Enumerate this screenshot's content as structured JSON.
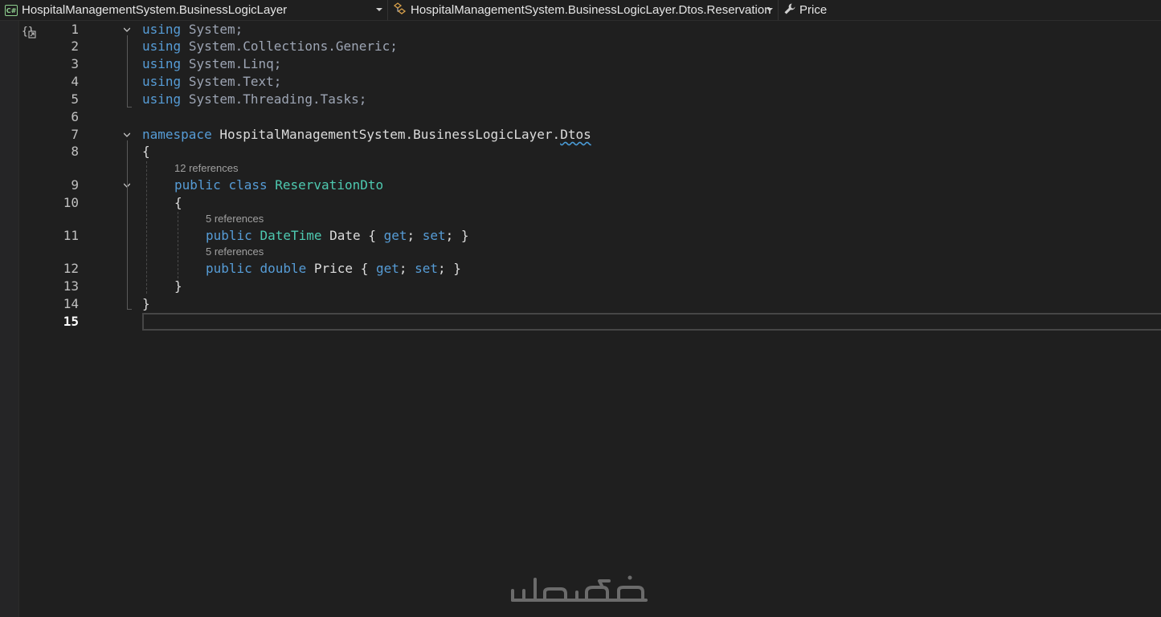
{
  "navbar": {
    "project_icon": "csharp-project-icon",
    "project": "HospitalManagementSystem.BusinessLogicLayer",
    "type_icon": "class-icon",
    "type": "HospitalManagementSystem.BusinessLogicLayer.Dtos.Reservation",
    "member_icon": "wrench-icon",
    "member": "Price"
  },
  "editor": {
    "line_numbers": [
      "1",
      "2",
      "3",
      "4",
      "5",
      "6",
      "7",
      "8",
      "9",
      "10",
      "11",
      "12",
      "13",
      "14",
      "15"
    ],
    "current_line": "15",
    "code_lens": {
      "class_refs": "12 references",
      "date_refs": "5 references",
      "price_refs": "5 references"
    },
    "tokens": {
      "using": "using",
      "system": "System",
      "collections_generic": "Collections.Generic",
      "linq": "Linq",
      "text": "Text",
      "threading_tasks": "Threading.Tasks",
      "namespace_kw": "namespace",
      "namespace_name": "HospitalManagementSystem.BusinessLogicLayer.",
      "namespace_last": "Dtos",
      "public": "public",
      "class": "class",
      "class_name": "ReservationDto",
      "datetime": "DateTime",
      "date_prop": "Date",
      "double": "double",
      "price_prop": "Price",
      "get": "get",
      "set": "set",
      "open_brace": "{",
      "close_brace": "}"
    }
  },
  "colors": {
    "keyword": "#569cd6",
    "type": "#4ec9b0",
    "text": "#dcdcdc",
    "background": "#1f1f1f"
  },
  "watermark": "خمسات"
}
